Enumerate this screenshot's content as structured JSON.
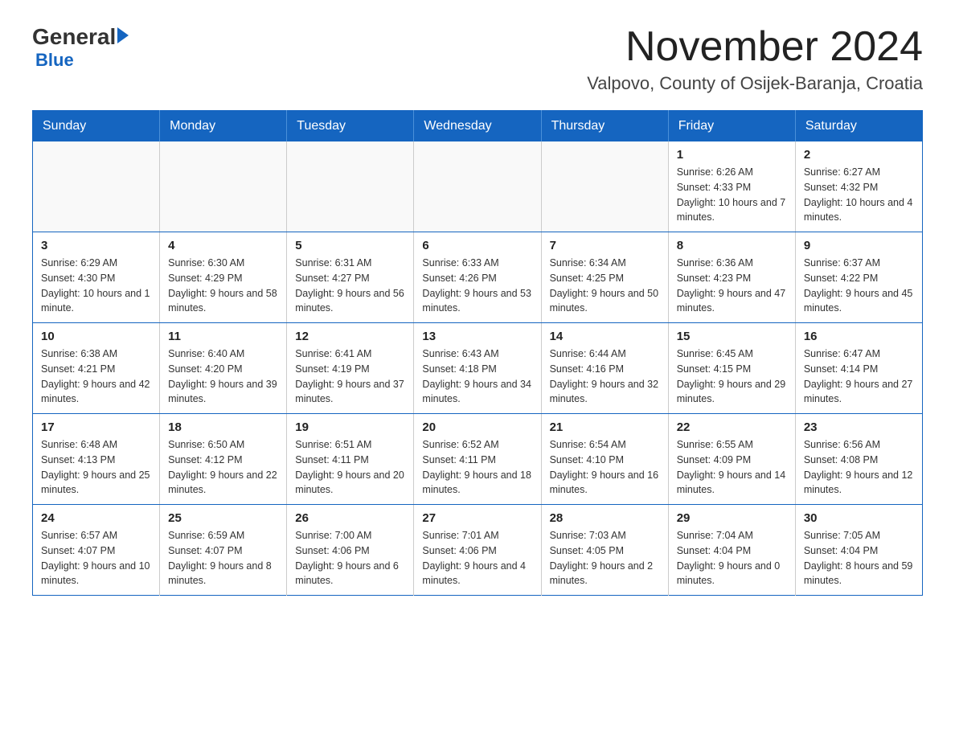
{
  "logo": {
    "general": "General",
    "blue": "Blue"
  },
  "title": "November 2024",
  "subtitle": "Valpovo, County of Osijek-Baranja, Croatia",
  "headers": [
    "Sunday",
    "Monday",
    "Tuesday",
    "Wednesday",
    "Thursday",
    "Friday",
    "Saturday"
  ],
  "weeks": [
    [
      {
        "day": "",
        "info": ""
      },
      {
        "day": "",
        "info": ""
      },
      {
        "day": "",
        "info": ""
      },
      {
        "day": "",
        "info": ""
      },
      {
        "day": "",
        "info": ""
      },
      {
        "day": "1",
        "info": "Sunrise: 6:26 AM\nSunset: 4:33 PM\nDaylight: 10 hours and 7 minutes."
      },
      {
        "day": "2",
        "info": "Sunrise: 6:27 AM\nSunset: 4:32 PM\nDaylight: 10 hours and 4 minutes."
      }
    ],
    [
      {
        "day": "3",
        "info": "Sunrise: 6:29 AM\nSunset: 4:30 PM\nDaylight: 10 hours and 1 minute."
      },
      {
        "day": "4",
        "info": "Sunrise: 6:30 AM\nSunset: 4:29 PM\nDaylight: 9 hours and 58 minutes."
      },
      {
        "day": "5",
        "info": "Sunrise: 6:31 AM\nSunset: 4:27 PM\nDaylight: 9 hours and 56 minutes."
      },
      {
        "day": "6",
        "info": "Sunrise: 6:33 AM\nSunset: 4:26 PM\nDaylight: 9 hours and 53 minutes."
      },
      {
        "day": "7",
        "info": "Sunrise: 6:34 AM\nSunset: 4:25 PM\nDaylight: 9 hours and 50 minutes."
      },
      {
        "day": "8",
        "info": "Sunrise: 6:36 AM\nSunset: 4:23 PM\nDaylight: 9 hours and 47 minutes."
      },
      {
        "day": "9",
        "info": "Sunrise: 6:37 AM\nSunset: 4:22 PM\nDaylight: 9 hours and 45 minutes."
      }
    ],
    [
      {
        "day": "10",
        "info": "Sunrise: 6:38 AM\nSunset: 4:21 PM\nDaylight: 9 hours and 42 minutes."
      },
      {
        "day": "11",
        "info": "Sunrise: 6:40 AM\nSunset: 4:20 PM\nDaylight: 9 hours and 39 minutes."
      },
      {
        "day": "12",
        "info": "Sunrise: 6:41 AM\nSunset: 4:19 PM\nDaylight: 9 hours and 37 minutes."
      },
      {
        "day": "13",
        "info": "Sunrise: 6:43 AM\nSunset: 4:18 PM\nDaylight: 9 hours and 34 minutes."
      },
      {
        "day": "14",
        "info": "Sunrise: 6:44 AM\nSunset: 4:16 PM\nDaylight: 9 hours and 32 minutes."
      },
      {
        "day": "15",
        "info": "Sunrise: 6:45 AM\nSunset: 4:15 PM\nDaylight: 9 hours and 29 minutes."
      },
      {
        "day": "16",
        "info": "Sunrise: 6:47 AM\nSunset: 4:14 PM\nDaylight: 9 hours and 27 minutes."
      }
    ],
    [
      {
        "day": "17",
        "info": "Sunrise: 6:48 AM\nSunset: 4:13 PM\nDaylight: 9 hours and 25 minutes."
      },
      {
        "day": "18",
        "info": "Sunrise: 6:50 AM\nSunset: 4:12 PM\nDaylight: 9 hours and 22 minutes."
      },
      {
        "day": "19",
        "info": "Sunrise: 6:51 AM\nSunset: 4:11 PM\nDaylight: 9 hours and 20 minutes."
      },
      {
        "day": "20",
        "info": "Sunrise: 6:52 AM\nSunset: 4:11 PM\nDaylight: 9 hours and 18 minutes."
      },
      {
        "day": "21",
        "info": "Sunrise: 6:54 AM\nSunset: 4:10 PM\nDaylight: 9 hours and 16 minutes."
      },
      {
        "day": "22",
        "info": "Sunrise: 6:55 AM\nSunset: 4:09 PM\nDaylight: 9 hours and 14 minutes."
      },
      {
        "day": "23",
        "info": "Sunrise: 6:56 AM\nSunset: 4:08 PM\nDaylight: 9 hours and 12 minutes."
      }
    ],
    [
      {
        "day": "24",
        "info": "Sunrise: 6:57 AM\nSunset: 4:07 PM\nDaylight: 9 hours and 10 minutes."
      },
      {
        "day": "25",
        "info": "Sunrise: 6:59 AM\nSunset: 4:07 PM\nDaylight: 9 hours and 8 minutes."
      },
      {
        "day": "26",
        "info": "Sunrise: 7:00 AM\nSunset: 4:06 PM\nDaylight: 9 hours and 6 minutes."
      },
      {
        "day": "27",
        "info": "Sunrise: 7:01 AM\nSunset: 4:06 PM\nDaylight: 9 hours and 4 minutes."
      },
      {
        "day": "28",
        "info": "Sunrise: 7:03 AM\nSunset: 4:05 PM\nDaylight: 9 hours and 2 minutes."
      },
      {
        "day": "29",
        "info": "Sunrise: 7:04 AM\nSunset: 4:04 PM\nDaylight: 9 hours and 0 minutes."
      },
      {
        "day": "30",
        "info": "Sunrise: 7:05 AM\nSunset: 4:04 PM\nDaylight: 8 hours and 59 minutes."
      }
    ]
  ]
}
